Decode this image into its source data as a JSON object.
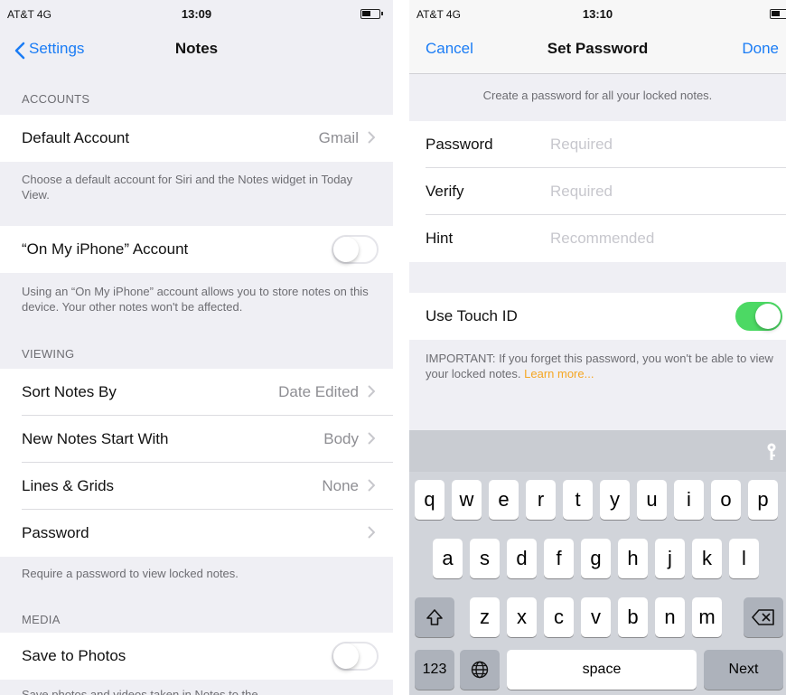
{
  "left": {
    "status": {
      "carrier": "AT&T 4G",
      "time": "13:09"
    },
    "nav": {
      "back_label": "Settings",
      "title": "Notes"
    },
    "accounts_header": "ACCOUNTS",
    "default_account": {
      "label": "Default Account",
      "value": "Gmail"
    },
    "default_account_footer": "Choose a default account for Siri and the Notes widget in Today View.",
    "on_my_iphone": {
      "label": "“On My iPhone” Account",
      "enabled": false
    },
    "on_my_iphone_footer": "Using an “On My iPhone” account allows you to store notes on this device. Your other notes won't be affected.",
    "viewing_header": "VIEWING",
    "viewing_rows": [
      {
        "label": "Sort Notes By",
        "value": "Date Edited"
      },
      {
        "label": "New Notes Start With",
        "value": "Body"
      },
      {
        "label": "Lines & Grids",
        "value": "None"
      },
      {
        "label": "Password",
        "value": ""
      }
    ],
    "password_footer": "Require a password to view locked notes.",
    "media_header": "MEDIA",
    "save_to_photos": {
      "label": "Save to Photos",
      "enabled": false
    },
    "save_footer_partial": "Save photos and videos taken in Notes to the"
  },
  "right": {
    "status": {
      "carrier": "AT&T 4G",
      "time": "13:10"
    },
    "nav": {
      "cancel_label": "Cancel",
      "title": "Set Password",
      "done_label": "Done"
    },
    "intro": "Create a password for all your locked notes.",
    "fields": [
      {
        "label": "Password",
        "placeholder": "Required"
      },
      {
        "label": "Verify",
        "placeholder": "Required"
      },
      {
        "label": "Hint",
        "placeholder": "Recommended"
      }
    ],
    "touch_id": {
      "label": "Use Touch ID",
      "enabled": true
    },
    "important_text": "IMPORTANT: If you forget this password, you won't be able to view your locked notes.",
    "learn_more": "Learn more...",
    "keyboard": {
      "row1": [
        "q",
        "w",
        "e",
        "r",
        "t",
        "y",
        "u",
        "i",
        "o",
        "p"
      ],
      "row2": [
        "a",
        "s",
        "d",
        "f",
        "g",
        "h",
        "j",
        "k",
        "l"
      ],
      "row3": [
        "z",
        "x",
        "c",
        "v",
        "b",
        "n",
        "m"
      ],
      "numbers_key": "123",
      "space_key": "space",
      "next_key": "Next"
    }
  },
  "colors": {
    "accent": "#1a7cf5",
    "toggle_on": "#4cd964",
    "learn_more": "#f5a623"
  }
}
